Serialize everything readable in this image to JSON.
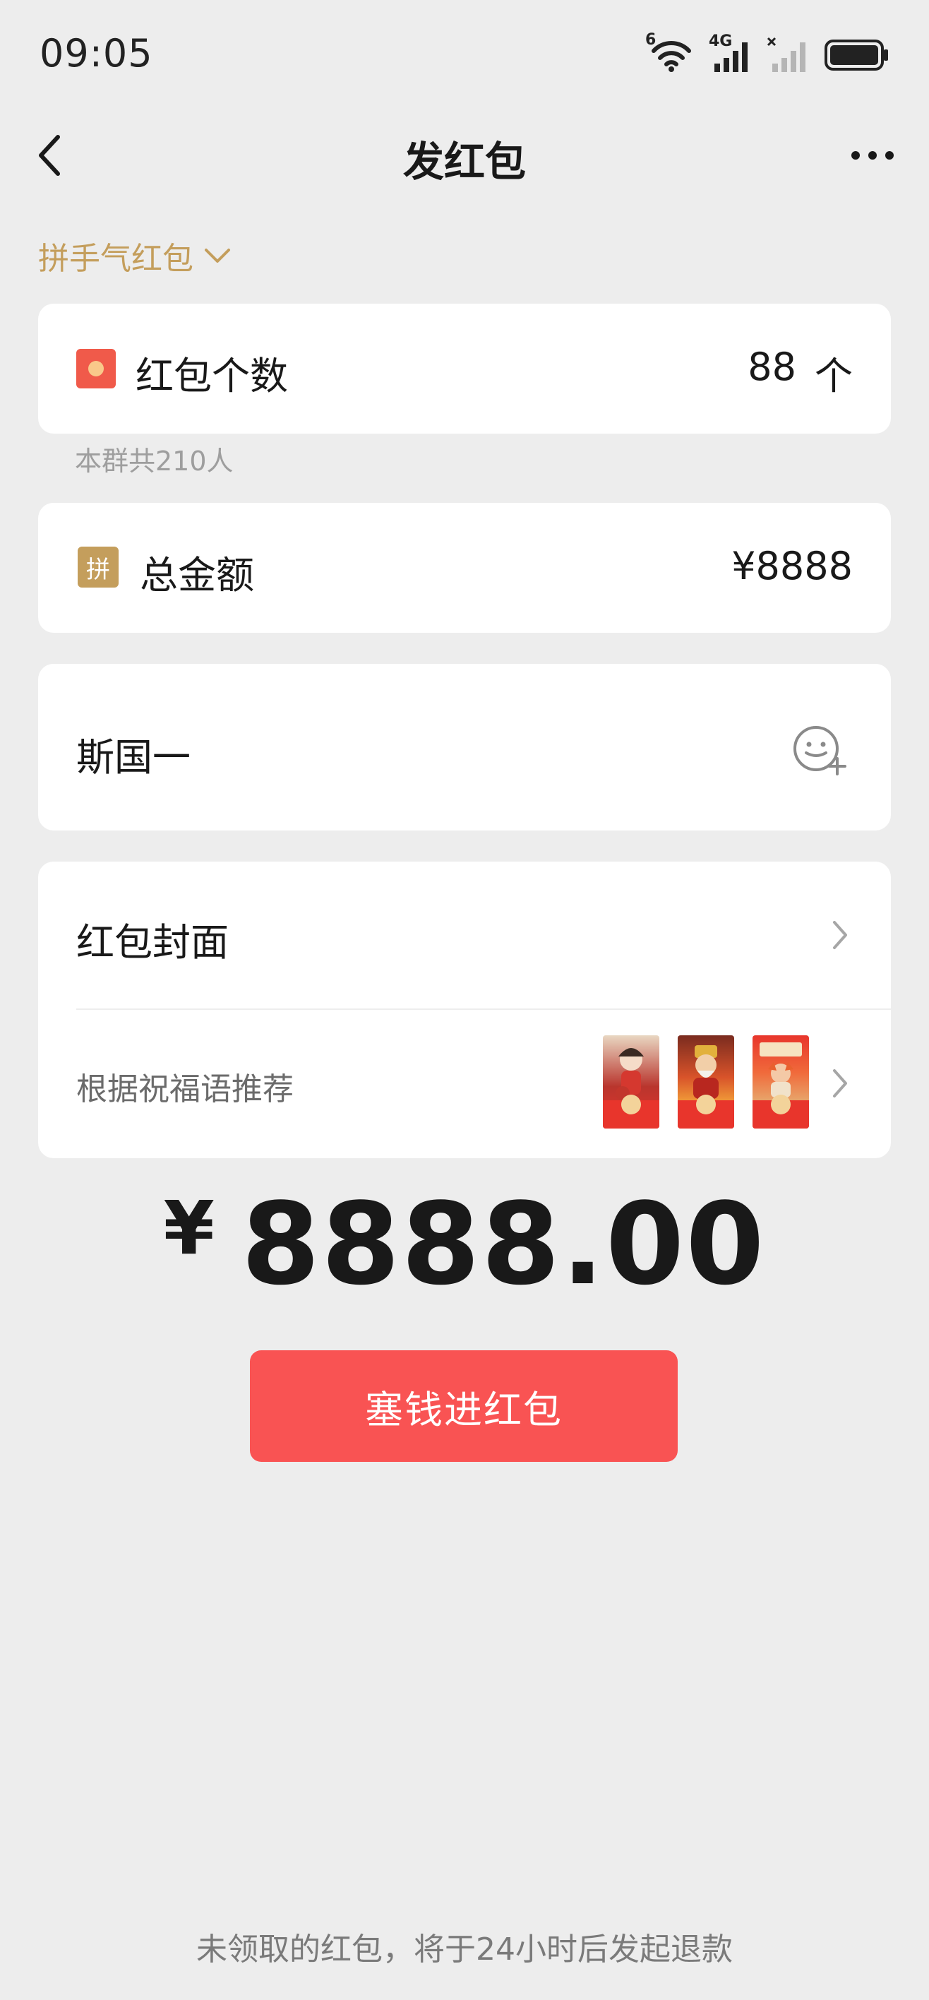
{
  "status_bar": {
    "time": "09:05",
    "icons": [
      "wifi-icon",
      "signal-4g-icon",
      "signal-no-sim-icon",
      "battery-icon"
    ],
    "wifi_badge": "6",
    "network_badge": "4G"
  },
  "nav": {
    "title": "发红包",
    "back_icon": "chevron-left-icon",
    "more_icon": "more-dots-icon"
  },
  "type_selector": {
    "label": "拼手气红包",
    "icon": "chevron-down-icon"
  },
  "count": {
    "label": "红包个数",
    "value": "88",
    "unit": "个",
    "hint": "本群共210人",
    "icon": "red-envelope-icon"
  },
  "amount": {
    "badge": "拼",
    "label": "总金额",
    "value": "¥8888"
  },
  "greeting": {
    "text": "斯国一",
    "icon": "emoji-add-icon"
  },
  "cover": {
    "label": "红包封面",
    "recommend_label": "根据祝福语推荐",
    "thumbnails": [
      "cover-thumb-girl",
      "cover-thumb-god-of-wealth",
      "cover-thumb-festive"
    ]
  },
  "total": {
    "currency": "¥",
    "value": "8888.00"
  },
  "submit": {
    "label": "塞钱进红包"
  },
  "footer": {
    "refund_note": "未领取的红包，将于24小时后发起退款"
  },
  "colors": {
    "background": "#EDEDED",
    "gold": "#C49E5C",
    "button_red": "#F95353",
    "envelope_red": "#F05A4A"
  }
}
